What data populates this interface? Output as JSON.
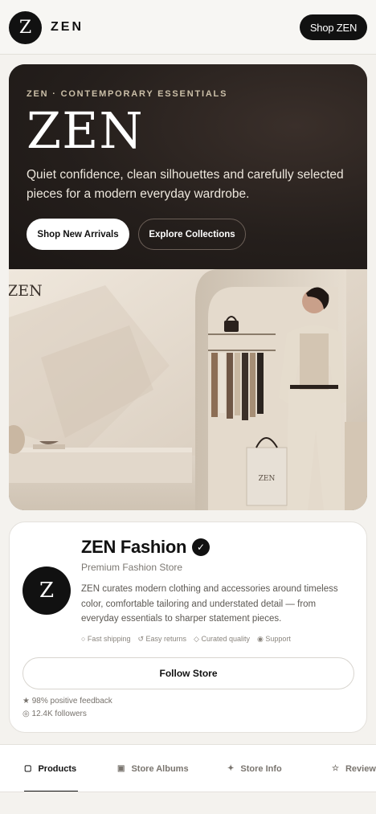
{
  "header": {
    "logo_letter": "Z",
    "brand": "ZEN",
    "shop_button": "Shop ZEN"
  },
  "hero": {
    "eyebrow": "ZEN · CONTEMPORARY ESSENTIALS",
    "title": "ZEN",
    "description": "Quiet confidence, clean silhouettes and carefully selected pieces for a modern everyday wardrobe.",
    "primary_button": "Shop New Arrivals",
    "secondary_button": "Explore Collections",
    "wall_sign": "ZEN",
    "bag_logo": "ZEN"
  },
  "store": {
    "avatar_letter": "Z",
    "name": "ZEN Fashion",
    "verified_mark": "✓",
    "subtitle": "Premium Fashion Store",
    "description": "ZEN curates modern clothing and accessories around timeless color, comfortable tailoring and understated detail — from everyday essentials to sharper statement pieces.",
    "features": [
      "○ Fast shipping",
      "↺ Easy returns",
      "◇ Curated quality",
      "◉ Support"
    ],
    "follow_button": "Follow Store",
    "stats": [
      "★ 98% positive feedback",
      "◎ 12.4K followers"
    ]
  },
  "tabs": [
    {
      "icon": "▢",
      "label": "Products",
      "active": true
    },
    {
      "icon": "▣",
      "label": "Store Albums",
      "active": false
    },
    {
      "icon": "✦",
      "label": "Store Info",
      "active": false
    },
    {
      "icon": "☆",
      "label": "Reviews",
      "active": false
    }
  ],
  "colors": {
    "accent": "#111111",
    "hero_bg": "#231d1a",
    "page_bg": "#f4f2ee"
  }
}
